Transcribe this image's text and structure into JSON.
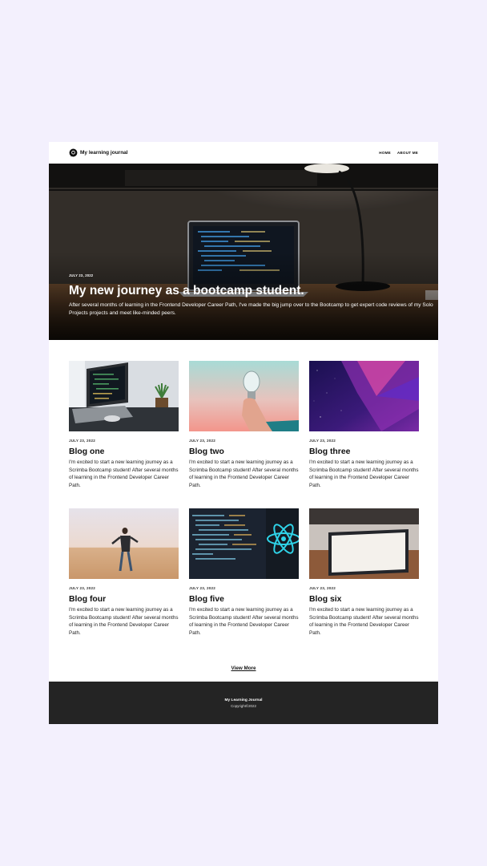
{
  "nav": {
    "brand": "My learning journal",
    "brand_icon": "chat-bubble-icon",
    "links": [
      "HOME",
      "ABOUT ME"
    ]
  },
  "hero": {
    "date": "JULY 23, 2022",
    "title": "My new journey as a bootcamp student.",
    "description": "After several months of learning in the Frontend Developer Career Path, I've made the big jump over to the Bootcamp to get expert code reviews of my Solo Projects projects and meet like-minded peers."
  },
  "posts": [
    {
      "date": "JULY 23, 2022",
      "title": "Blog one",
      "text": "I'm excited to start a new learning journey as a Scrimba Bootcamp student! After several months of learning in the Frontend Developer Career Path."
    },
    {
      "date": "JULY 23, 2022",
      "title": "Blog two",
      "text": "I'm excited to start a new learning journey as a Scrimba Bootcamp student! After several months of learning in the Frontend Developer Career Path."
    },
    {
      "date": "JULY 23, 2022",
      "title": "Blog three",
      "text": "I'm excited to start a new learning journey as a Scrimba Bootcamp student! After several months of learning in the Frontend Developer Career Path."
    },
    {
      "date": "JULY 23, 2022",
      "title": "Blog four",
      "text": "I'm excited to start a new learning journey as a Scrimba Bootcamp student! After several months of learning in the Frontend Developer Career Path."
    },
    {
      "date": "JULY 23, 2022",
      "title": "Blog five",
      "text": "I'm excited to start a new learning journey as a Scrimba Bootcamp student! After several months of learning in the Frontend Developer Career Path."
    },
    {
      "date": "JULY 23, 2022",
      "title": "Blog six",
      "text": "I'm excited to start a new learning journey as a Scrimba Bootcamp student! After several months of learning in the Frontend Developer Career Path."
    }
  ],
  "view_more": "View More",
  "footer": {
    "title": "My Learning Journal",
    "copyright": "Copyright©2022"
  },
  "colors": {
    "page_background": "#f3f0fd",
    "footer_background": "#242424"
  }
}
